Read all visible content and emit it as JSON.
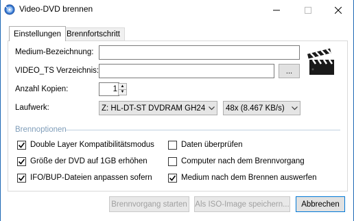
{
  "window": {
    "title": "Video-DVD brennen",
    "minimize_glyph": "—",
    "maximize_glyph": "☐",
    "close_glyph": "✕"
  },
  "tabs": [
    {
      "label": "Einstellungen",
      "active": true
    },
    {
      "label": "Brennfortschritt",
      "active": false
    }
  ],
  "form": {
    "medium_label": "Medium-Bezeichnung:",
    "medium_value": "",
    "video_ts_label": "VIDEO_TS Verzeichnis:",
    "video_ts_value": "",
    "browse_label": "...",
    "copies_label": "Anzahl Kopien:",
    "copies_value": "1",
    "drive_label": "Laufwerk:",
    "drive_value": "Z: HL-DT-ST DVDRAM GH24N",
    "speed_value": "48x (8.467 KB/s)"
  },
  "options": {
    "group_label": "Brennoptionen",
    "items": [
      {
        "label": "Double Layer Kompatibilitätsmodus",
        "checked": true
      },
      {
        "label": "Größe der DVD auf 1GB erhöhen",
        "checked": true
      },
      {
        "label": "IFO/BUP-Dateien anpassen sofern",
        "checked": true
      },
      {
        "label": "Daten überprüfen",
        "checked": false
      },
      {
        "label": "Computer nach dem Brennvorgang",
        "checked": false
      },
      {
        "label": "Medium nach dem Brennen auswerfen",
        "checked": true
      }
    ]
  },
  "buttons": {
    "start_label": "Brennvorgang starten",
    "save_iso_label": "Als ISO-Image speichern...",
    "cancel_label": "Abbrechen"
  },
  "icons": {
    "app": "dvd-burn-icon",
    "clapper": "clapperboard-icon"
  },
  "colors": {
    "accent": "#0078d7",
    "group_label": "#7f9db9",
    "window_border": "#1b67b3"
  }
}
